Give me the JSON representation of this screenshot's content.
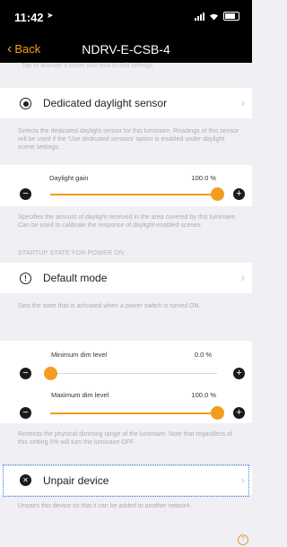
{
  "status_bar": {
    "time": "11:42"
  },
  "nav": {
    "back_label": "Back",
    "title": "NDRV-E-CSB-4"
  },
  "faded_hint": "Tap to activate a mode and hold to edit settings",
  "daylight_sensor": {
    "label": "Dedicated daylight sensor",
    "description": "Selects the dedicated daylight sensor for this luminaire. Readings of this sensor will be used if the 'Use dedicated sensors' option is enabled under daylight scene settings."
  },
  "daylight_gain": {
    "label": "Daylight gain",
    "value_text": "100.0 %",
    "value": 100.0,
    "description": "Specifies the amount of daylight received in the area covered by this luminaire. Can be used to calibrate the response of daylight-enabled scenes."
  },
  "startup_section": {
    "heading": "STARTUP STATE FOR POWER ON",
    "default_mode_label": "Default mode",
    "description": "Sets the state that is activated when a power switch is turned ON."
  },
  "min_dim": {
    "label": "Minimum dim level",
    "value_text": "0.0 %",
    "value": 0.0
  },
  "max_dim": {
    "label": "Maximum dim level",
    "value_text": "100.0 %",
    "value": 100.0,
    "description": "Restricts the physical dimming range of the luminaire. Note that regardless of this setting 0% will turn the luminaire OFF."
  },
  "unpair": {
    "label": "Unpair device",
    "description": "Unpairs this device so that it can be added to another network."
  },
  "icons": {
    "back": "chevron-left-icon",
    "sensor": "radio-icon",
    "default_mode": "info-icon",
    "unpair": "close-icon",
    "help": "help-icon"
  },
  "colors": {
    "accent": "#f39c1e",
    "background": "#efeff4",
    "focus": "#3b7bd0"
  }
}
